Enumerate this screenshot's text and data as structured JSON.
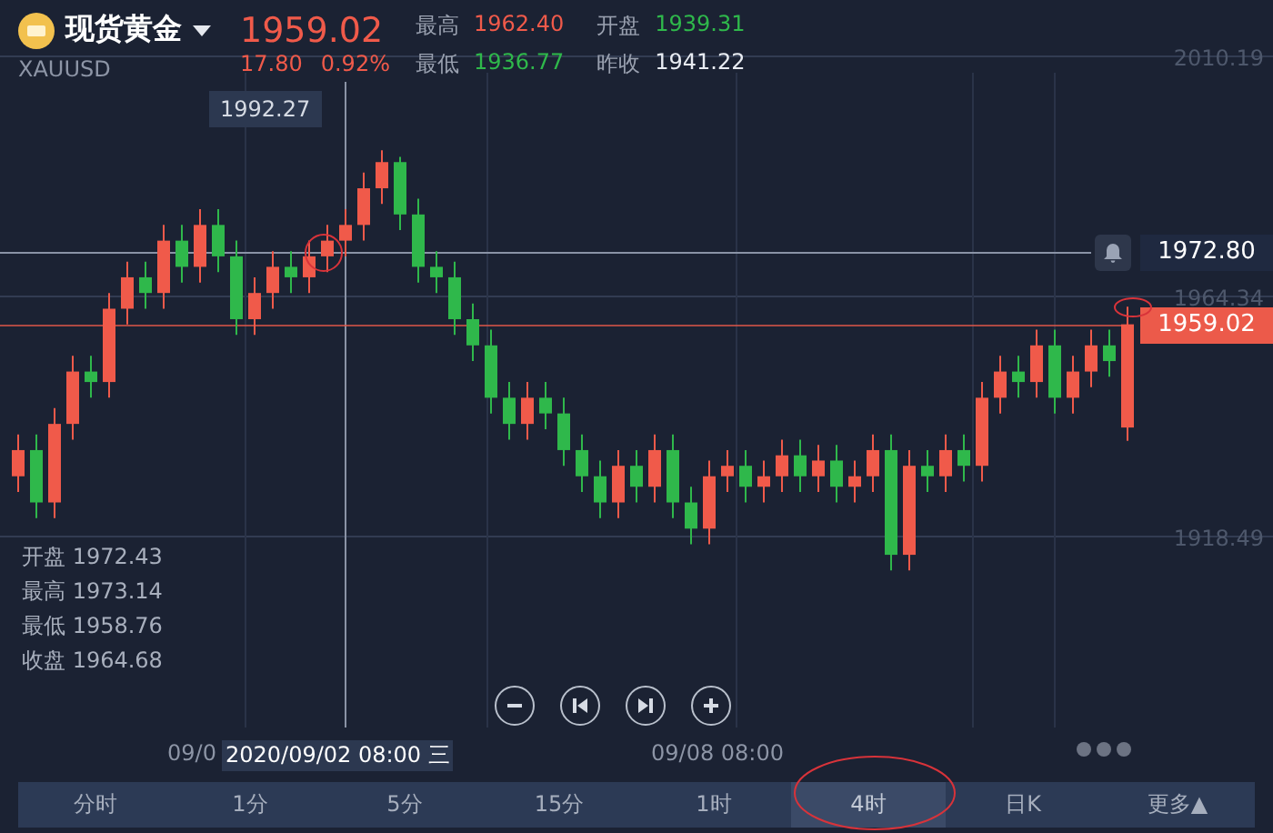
{
  "header": {
    "name": "现货黄金",
    "symbol": "XAUUSD",
    "price": "1959.02",
    "change": "17.80",
    "change_pct": "0.92%",
    "stats": [
      {
        "label": "最高",
        "value": "1962.40",
        "color": "#f05a4a"
      },
      {
        "label": "开盘",
        "value": "1939.31",
        "color": "#2fb84b"
      },
      {
        "label": "最低",
        "value": "1936.77",
        "color": "#2fb84b"
      },
      {
        "label": "昨收",
        "value": "1941.22",
        "color": "#e8ecf2"
      }
    ]
  },
  "chart": {
    "chart_data": {
      "type": "candlestick",
      "grid": true,
      "ylim": [
        1918.49,
        2010.19
      ],
      "yticks": [
        1918.49,
        1964.34,
        2010.19
      ],
      "ohlc": [
        [
          1930,
          1938,
          1927,
          1935
        ],
        [
          1935,
          1938,
          1922,
          1925
        ],
        [
          1925,
          1943,
          1922,
          1940
        ],
        [
          1940,
          1953,
          1937,
          1950
        ],
        [
          1950,
          1953,
          1945,
          1948
        ],
        [
          1948,
          1965,
          1945,
          1962
        ],
        [
          1962,
          1971,
          1959,
          1968
        ],
        [
          1968,
          1971,
          1962,
          1965
        ],
        [
          1965,
          1978,
          1962,
          1975
        ],
        [
          1975,
          1978,
          1967,
          1970
        ],
        [
          1970,
          1981,
          1967,
          1978
        ],
        [
          1978,
          1981,
          1969,
          1972
        ],
        [
          1972,
          1975,
          1957,
          1960
        ],
        [
          1960,
          1968,
          1957,
          1965
        ],
        [
          1965,
          1973,
          1962,
          1970
        ],
        [
          1970,
          1973,
          1965,
          1968
        ],
        [
          1968,
          1975,
          1965,
          1972
        ],
        [
          1972,
          1978,
          1969,
          1975
        ],
        [
          1975,
          1981,
          1972,
          1978
        ],
        [
          1978,
          1988,
          1975,
          1985
        ],
        [
          1985,
          1992.27,
          1982,
          1990
        ],
        [
          1990,
          1991,
          1977,
          1980
        ],
        [
          1980,
          1983,
          1967,
          1970
        ],
        [
          1970,
          1973,
          1965,
          1968
        ],
        [
          1968,
          1971,
          1957,
          1960
        ],
        [
          1960,
          1963,
          1952,
          1955
        ],
        [
          1955,
          1958,
          1942,
          1945
        ],
        [
          1945,
          1948,
          1937,
          1940
        ],
        [
          1940,
          1948,
          1937,
          1945
        ],
        [
          1945,
          1948,
          1939,
          1942
        ],
        [
          1942,
          1945,
          1932,
          1935
        ],
        [
          1935,
          1938,
          1927,
          1930
        ],
        [
          1930,
          1933,
          1922,
          1925
        ],
        [
          1925,
          1935,
          1922,
          1932
        ],
        [
          1932,
          1935,
          1925,
          1928
        ],
        [
          1928,
          1938,
          1925,
          1935
        ],
        [
          1935,
          1938,
          1922,
          1925
        ],
        [
          1925,
          1928,
          1917,
          1920
        ],
        [
          1920,
          1933,
          1917,
          1930
        ],
        [
          1930,
          1935,
          1927,
          1932
        ],
        [
          1932,
          1935,
          1925,
          1928
        ],
        [
          1928,
          1933,
          1925,
          1930
        ],
        [
          1930,
          1937,
          1927,
          1934
        ],
        [
          1934,
          1937,
          1927,
          1930
        ],
        [
          1930,
          1936,
          1927,
          1933
        ],
        [
          1933,
          1936,
          1925,
          1928
        ],
        [
          1928,
          1933,
          1925,
          1930
        ],
        [
          1930,
          1938,
          1927,
          1935
        ],
        [
          1935,
          1938,
          1912,
          1915
        ],
        [
          1915,
          1935,
          1912,
          1932
        ],
        [
          1932,
          1935,
          1927,
          1930
        ],
        [
          1930,
          1938,
          1927,
          1935
        ],
        [
          1935,
          1938,
          1929,
          1932
        ],
        [
          1932,
          1948,
          1929,
          1945
        ],
        [
          1945,
          1953,
          1942,
          1950
        ],
        [
          1950,
          1953,
          1945,
          1948
        ],
        [
          1948,
          1958,
          1945,
          1955
        ],
        [
          1955,
          1958,
          1942,
          1945
        ],
        [
          1945,
          1953,
          1942,
          1950
        ],
        [
          1950,
          1958,
          1947,
          1955
        ],
        [
          1955,
          1958,
          1949,
          1952
        ],
        [
          1939.31,
          1962.4,
          1936.77,
          1959.02
        ]
      ]
    },
    "high_label": "1992.27",
    "crosshair_price": "1972.80",
    "last_price": "1959.02",
    "ohlc": [
      {
        "label": "开盘",
        "value": "1972.43"
      },
      {
        "label": "最高",
        "value": "1973.14"
      },
      {
        "label": "最低",
        "value": "1958.76"
      },
      {
        "label": "收盘",
        "value": "1964.68"
      }
    ],
    "time_labels": [
      "09/0",
      "09/08 08:00"
    ],
    "crosshair_time": "2020/09/02 08:00 三"
  },
  "tabs": [
    {
      "label": "分时",
      "selected": false
    },
    {
      "label": "1分",
      "selected": false
    },
    {
      "label": "5分",
      "selected": false
    },
    {
      "label": "15分",
      "selected": false
    },
    {
      "label": "1时",
      "selected": false
    },
    {
      "label": "4时",
      "selected": true
    },
    {
      "label": "日K",
      "selected": false
    },
    {
      "label": "更多▲",
      "selected": false
    }
  ]
}
